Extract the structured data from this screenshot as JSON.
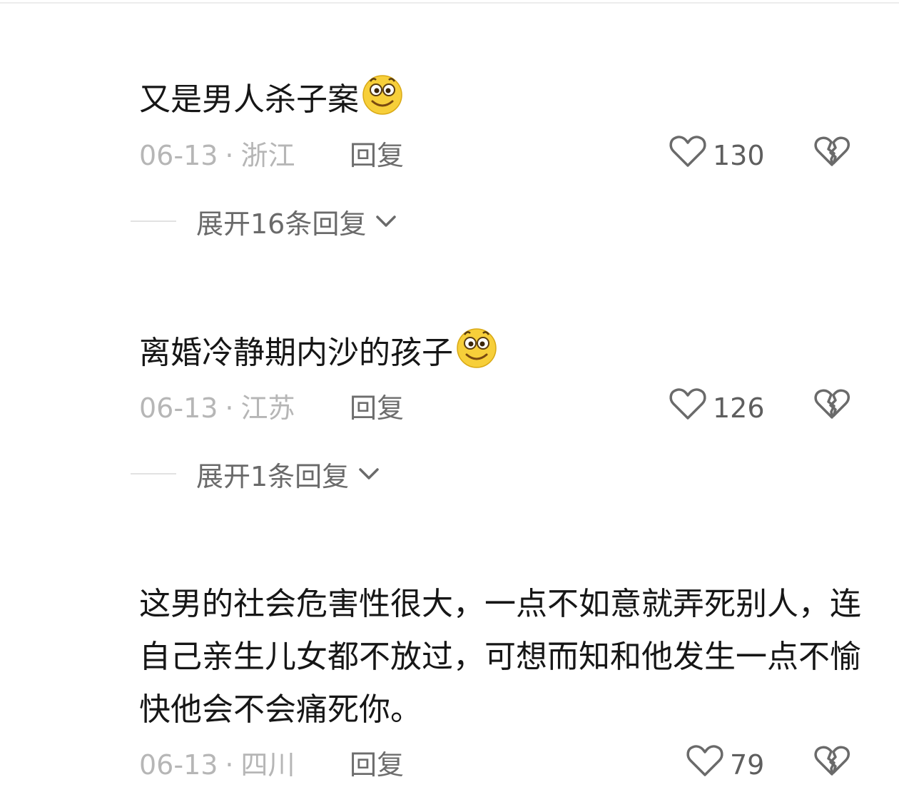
{
  "comments": [
    {
      "text": "又是男人杀子案",
      "has_emoji": true,
      "emoji_icon": "smiley-emoji-icon",
      "date": "06-13",
      "separator": "·",
      "region": "浙江",
      "reply_label": "回复",
      "likes": "130",
      "expand_label": "展开16条回复"
    },
    {
      "text": "离婚冷静期内沙的孩子",
      "has_emoji": true,
      "emoji_icon": "smiley-emoji-icon",
      "date": "06-13",
      "separator": "·",
      "region": "江苏",
      "reply_label": "回复",
      "likes": "126",
      "expand_label": "展开1条回复"
    },
    {
      "text": "这男的社会危害性很大，一点不如意就弄死别人，连自己亲生儿女都不放过，可想而知和他发生一点不愉快他会不会痛死你。",
      "has_emoji": false,
      "date": "06-13",
      "separator": "·",
      "region": "四川",
      "reply_label": "回复",
      "likes": "79"
    }
  ],
  "icons": {
    "like": "heart-outline-icon",
    "dislike": "broken-heart-icon",
    "expand": "chevron-down-icon"
  },
  "colors": {
    "text_primary": "#161616",
    "text_meta": "#b6b6b6",
    "text_secondary": "#6d6d6d",
    "emoji_yellow": "#f7cf3a"
  }
}
